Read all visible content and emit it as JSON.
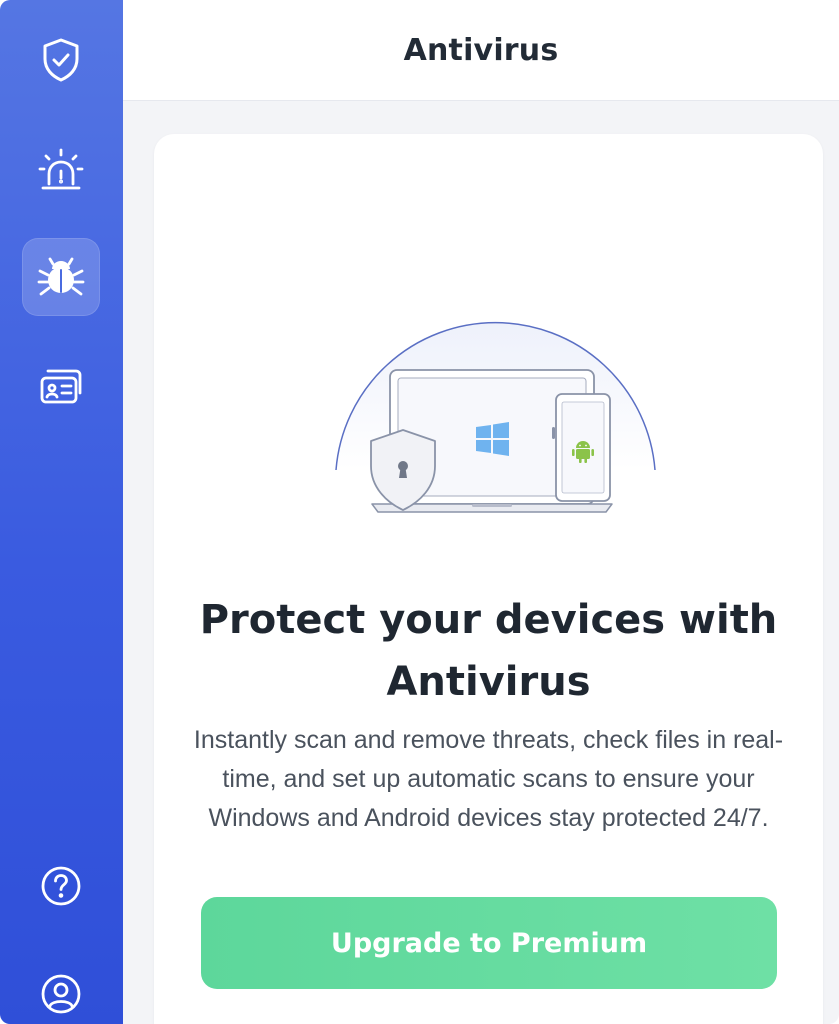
{
  "header": {
    "title": "Antivirus"
  },
  "sidebar": {
    "items": [
      {
        "name": "shield-check",
        "icon": "shield-check-icon",
        "active": false
      },
      {
        "name": "alarm",
        "icon": "alarm-siren-icon",
        "active": false
      },
      {
        "name": "antivirus",
        "icon": "bug-icon",
        "active": true
      },
      {
        "name": "identity",
        "icon": "id-card-icon",
        "active": false
      }
    ],
    "bottom_items": [
      {
        "name": "help",
        "icon": "help-circle-icon"
      },
      {
        "name": "account",
        "icon": "user-circle-icon"
      }
    ]
  },
  "main": {
    "illustration": {
      "icons": [
        "laptop-icon",
        "windows-logo-icon",
        "phone-icon",
        "android-logo-icon",
        "lock-shield-icon"
      ]
    },
    "headline": "Protect your devices with Antivirus",
    "description": "Instantly scan and remove threats, check files in real-time, and set up automatic scans to ensure your Windows and Android devices stay protected 24/7.",
    "cta_label": "Upgrade to Premium"
  },
  "colors": {
    "sidebar_top": "#5576e3",
    "sidebar_bottom": "#2f4fd8",
    "cta": "#65dba0",
    "windows_logo": "#6fb3ef",
    "android_logo": "#8bc34a"
  }
}
